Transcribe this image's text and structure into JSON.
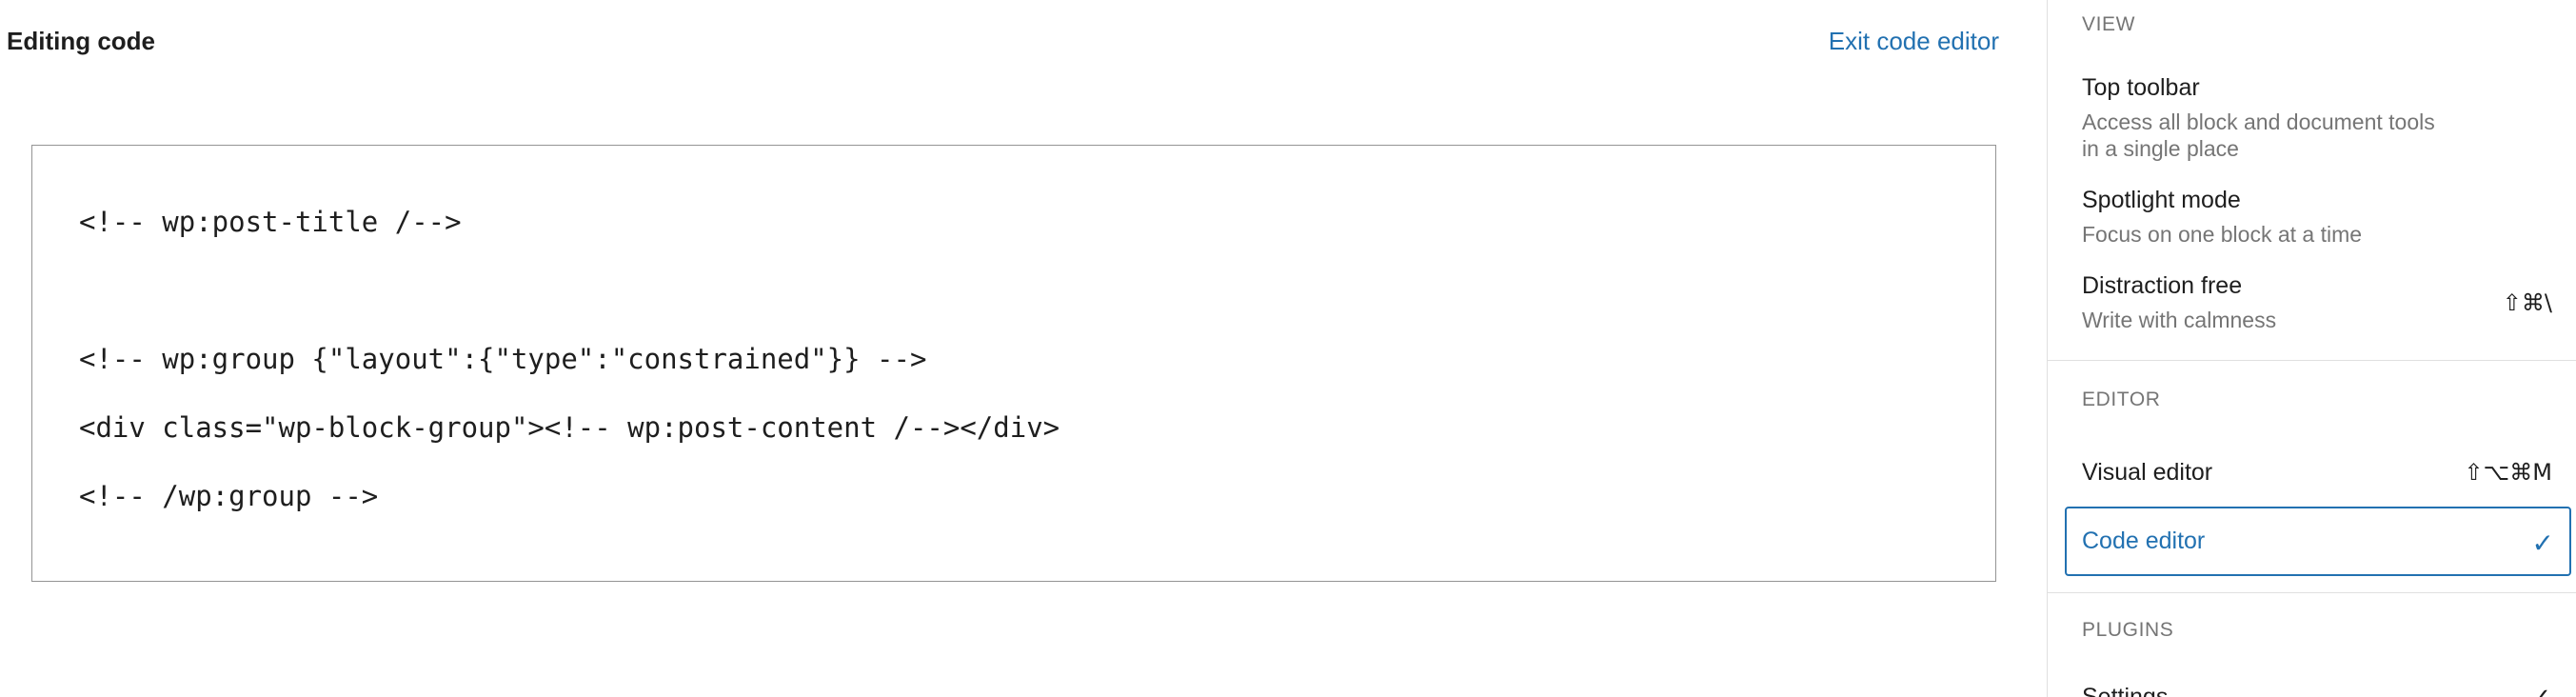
{
  "header": {
    "title": "Editing code",
    "exit_label": "Exit code editor"
  },
  "code": {
    "lines": [
      "<!-- wp:post-title /-->",
      "",
      "<!-- wp:group {\"layout\":{\"type\":\"constrained\"}} -->",
      "<div class=\"wp-block-group\"><!-- wp:post-content /--></div>",
      "<!-- /wp:group -->"
    ]
  },
  "menu": {
    "view": {
      "label": "VIEW",
      "items": [
        {
          "label": "Top toolbar",
          "description": "Access all block and document tools in a single place",
          "shortcut": ""
        },
        {
          "label": "Spotlight mode",
          "description": "Focus on one block at a time",
          "shortcut": ""
        },
        {
          "label": "Distraction free",
          "description": "Write with calmness",
          "shortcut": "⇧⌘\\"
        }
      ]
    },
    "editor": {
      "label": "EDITOR",
      "items": [
        {
          "label": "Visual editor",
          "shortcut": "⇧⌥⌘M",
          "selected": false
        },
        {
          "label": "Code editor",
          "shortcut": "",
          "selected": true,
          "icon": "check-icon"
        }
      ]
    },
    "plugins": {
      "label": "PLUGINS",
      "items": [
        {
          "label": "Settings",
          "icon": "check-icon"
        }
      ]
    }
  },
  "colors": {
    "accent": "#2271b1",
    "text": "#1e1e1e",
    "muted": "#757575",
    "border": "#949494",
    "divider": "#e0e0e0"
  }
}
